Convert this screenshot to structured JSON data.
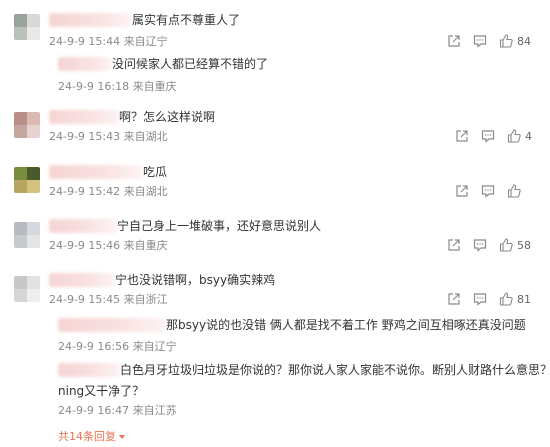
{
  "comments": [
    {
      "text": "属实有点不尊重人了",
      "date": "24-9-9 15:44",
      "location": "来自辽宁",
      "likes": "84"
    },
    {
      "text": "没问候家人都已经算不错的了",
      "date": "24-9-9 16:18",
      "location": "来自重庆"
    },
    {
      "text": "啊？怎么这样说啊",
      "date": "24-9-9 15:43",
      "location": "来自湖北",
      "likes": "4"
    },
    {
      "text": "吃瓜",
      "date": "24-9-9 15:42",
      "location": "来自湖北"
    },
    {
      "text": "宁自己身上一堆破事，还好意思说别人",
      "date": "24-9-9 15:46",
      "location": "来自重庆",
      "likes": "58"
    },
    {
      "text": "宁也没说错啊，bsyy确实辣鸡",
      "date": "24-9-9 15:45",
      "location": "来自浙江",
      "likes": "81"
    },
    {
      "text": "那bsyy说的也没错 俩人都是找不着工作 野鸡之间互相啄还真没问题",
      "date": "24-9-9 16:56",
      "location": "来自辽宁"
    },
    {
      "text_line1": "白色月牙垃圾归垃圾是你说的？那你说人家人家能不说你。断别人财路什么意思？",
      "text_line2": "ning又干净了？",
      "date": "24-9-9 16:47",
      "location": "来自江苏"
    }
  ],
  "more_replies": "共14条回复",
  "icons": {
    "share": "share-icon",
    "comment": "comment-icon",
    "like": "thumbs-up-icon",
    "expand": "caret-down-icon"
  },
  "colors": {
    "accent": "#eb7350",
    "meta": "#8a8a8a",
    "text": "#333333"
  }
}
